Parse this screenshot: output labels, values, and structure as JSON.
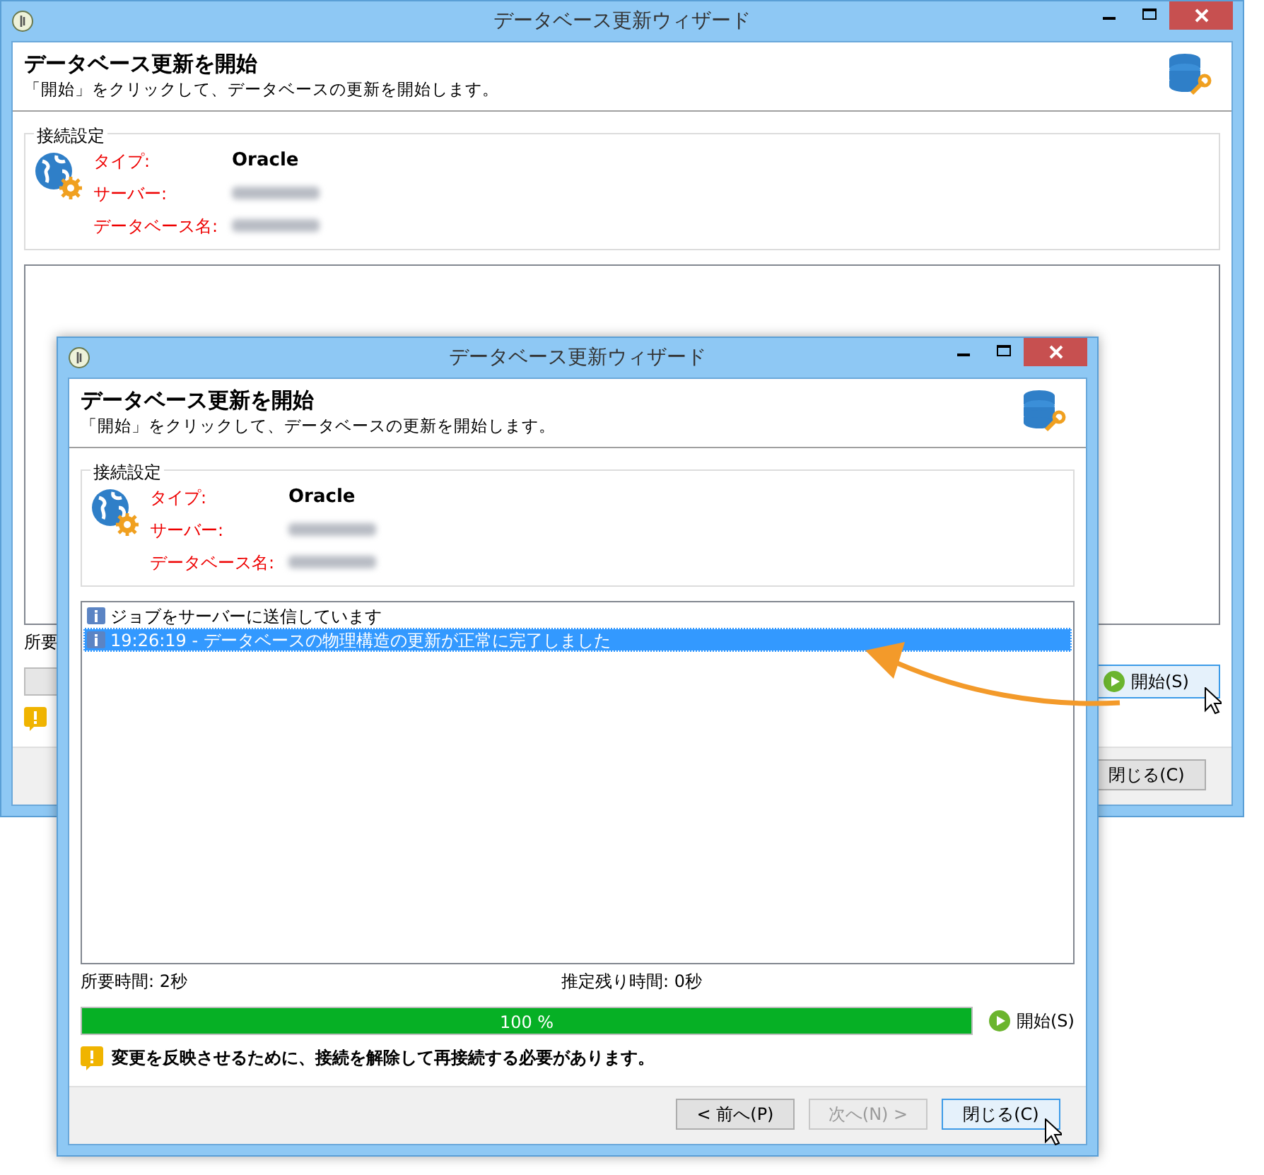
{
  "windows": [
    {
      "title": "データベース更新ウィザード",
      "heading": "データベース更新を開始",
      "subtitle": "「開始」をクリックして、データベースの更新を開始します。",
      "group_title": "接続設定",
      "fields": [
        {
          "label": "タイプ:",
          "value": "Oracle",
          "blurred": false
        },
        {
          "label": "サーバー:",
          "blurred": true
        },
        {
          "label": "データベース名:",
          "blurred": true
        }
      ],
      "elapsed": "所要",
      "progress": {
        "level": 0
      },
      "start_button": {
        "label": "開始(S)",
        "hovered": true,
        "cursor": true
      },
      "buttons": [
        {
          "label": "閉じる(C)",
          "disabled": false,
          "hovered": false,
          "cursor": false
        }
      ]
    },
    {
      "title": "データベース更新ウィザード",
      "heading": "データベース更新を開始",
      "subtitle": "「開始」をクリックして、データベースの更新を開始します。",
      "group_title": "接続設定",
      "fields": [
        {
          "label": "タイプ:",
          "value": "Oracle",
          "blurred": false
        },
        {
          "label": "サーバー:",
          "blurred": true
        },
        {
          "label": "データベース名:",
          "blurred": true
        }
      ],
      "log": [
        {
          "text": "ジョブをサーバーに送信しています",
          "selected": false
        },
        {
          "text": "19:26:19 - データベースの物理構造の更新が正常に完了しました",
          "selected": true
        }
      ],
      "elapsed": "所要時間:  2秒",
      "remaining": "推定残り時間:  0秒",
      "progress": {
        "level": 1,
        "label": "100 %"
      },
      "start_button": {
        "label": "開始(S)",
        "hovered": false,
        "cursor": false
      },
      "warning": {
        "text": "変更を反映させるために、接続を解除して再接続する必要があります。"
      },
      "buttons": [
        {
          "label": "< 前へ(P)",
          "disabled": false,
          "hovered": false,
          "cursor": false
        },
        {
          "label": "次へ(N) >",
          "disabled": true,
          "hovered": false,
          "cursor": false
        },
        {
          "label": "閉じる(C)",
          "disabled": false,
          "hovered": true,
          "cursor": true
        }
      ]
    }
  ]
}
